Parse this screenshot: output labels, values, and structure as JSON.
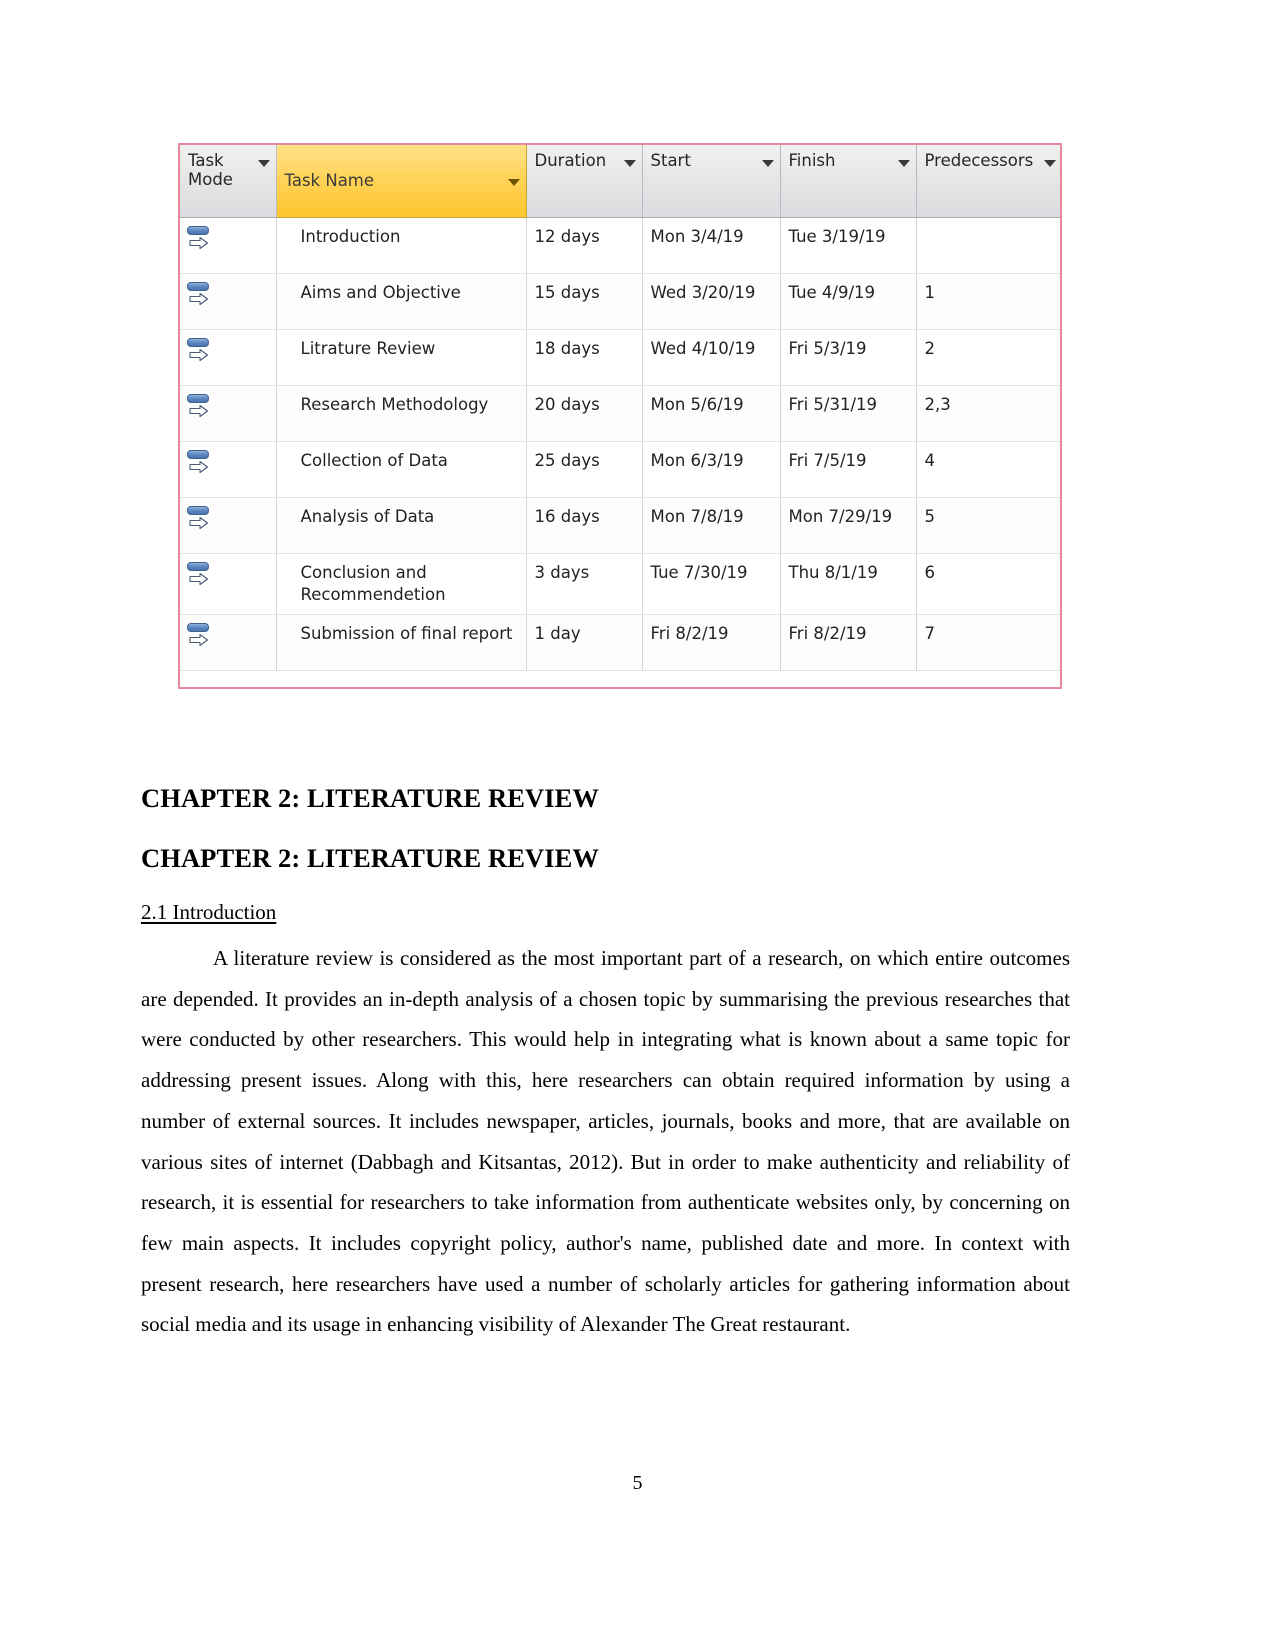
{
  "figure": {
    "name": "ms-project-task-schedule",
    "columns": [
      {
        "key": "task_mode",
        "label": "Task\nMode",
        "has_filter": true,
        "highlighted": false
      },
      {
        "key": "task_name",
        "label": "Task Name",
        "has_filter": true,
        "highlighted": true
      },
      {
        "key": "duration",
        "label": "Duration",
        "has_filter": true,
        "highlighted": false
      },
      {
        "key": "start",
        "label": "Start",
        "has_filter": true,
        "highlighted": false
      },
      {
        "key": "finish",
        "label": "Finish",
        "has_filter": true,
        "highlighted": false
      },
      {
        "key": "predecessors",
        "label": "Predecessors",
        "has_filter": true,
        "highlighted": false
      }
    ],
    "header_labels": {
      "task_mode_line1": "Task",
      "task_mode_line2": "Mode",
      "task_name": "Task Name",
      "duration": "Duration",
      "start": "Start",
      "finish": "Finish",
      "predecessors": "Predecessors"
    },
    "task_mode_icon": "auto-scheduled-icon",
    "rows": [
      {
        "mode": "auto-scheduled-icon",
        "name": "Introduction",
        "duration": "12 days",
        "start": "Mon 3/4/19",
        "finish": "Tue 3/19/19",
        "predecessors": ""
      },
      {
        "mode": "auto-scheduled-icon",
        "name": "Aims and Objective",
        "duration": "15 days",
        "start": "Wed 3/20/19",
        "finish": "Tue 4/9/19",
        "predecessors": "1"
      },
      {
        "mode": "auto-scheduled-icon",
        "name": "Litrature Review",
        "duration": "18 days",
        "start": "Wed 4/10/19",
        "finish": "Fri 5/3/19",
        "predecessors": "2"
      },
      {
        "mode": "auto-scheduled-icon",
        "name": "Research Methodology",
        "duration": "20 days",
        "start": "Mon 5/6/19",
        "finish": "Fri 5/31/19",
        "predecessors": "2,3"
      },
      {
        "mode": "auto-scheduled-icon",
        "name": "Collection of Data",
        "duration": "25 days",
        "start": "Mon 6/3/19",
        "finish": "Fri 7/5/19",
        "predecessors": "4"
      },
      {
        "mode": "auto-scheduled-icon",
        "name": "Analysis of Data",
        "duration": "16 days",
        "start": "Mon 7/8/19",
        "finish": "Mon 7/29/19",
        "predecessors": "5"
      },
      {
        "mode": "auto-scheduled-icon",
        "name": "Conclusion and Recommendetion",
        "duration": "3 days",
        "start": "Tue 7/30/19",
        "finish": "Thu 8/1/19",
        "predecessors": "6"
      },
      {
        "mode": "auto-scheduled-icon",
        "name": "Submission of final report",
        "duration": "1 day",
        "start": "Fri 8/2/19",
        "finish": "Fri 8/2/19",
        "predecessors": "7"
      }
    ],
    "colors": {
      "border": "#e8899a",
      "header_highlight": "#ffd255",
      "header_default": "#e4e4e6",
      "task_mode_icon": "#5b84bd"
    }
  },
  "document": {
    "heading_1": "CHAPTER 2: LITERATURE REVIEW",
    "heading_2": "CHAPTER 2: LITERATURE REVIEW",
    "section_heading": "2.1 Introduction",
    "paragraph": "A literature review is considered as the most important part of a research, on which entire outcomes are depended. It provides an in-depth analysis of a chosen topic by summarising the previous researches that were conducted by other researchers. This would help in integrating what is known about a same topic for addressing present issues. Along with this, here researchers can obtain required information by using a number of external sources. It includes newspaper, articles, journals, books and more, that are available on various sites of internet (Dabbagh and Kitsantas, 2012). But in order to make authenticity and reliability of research, it is essential for researchers to take information from authenticate websites only, by concerning on few main aspects. It includes copyright policy, author's name, published date and more. In context with present research, here researchers have used a number of scholarly articles for gathering information about social media and its usage in enhancing visibility of Alexander The Great restaurant.",
    "page_number": "5"
  }
}
